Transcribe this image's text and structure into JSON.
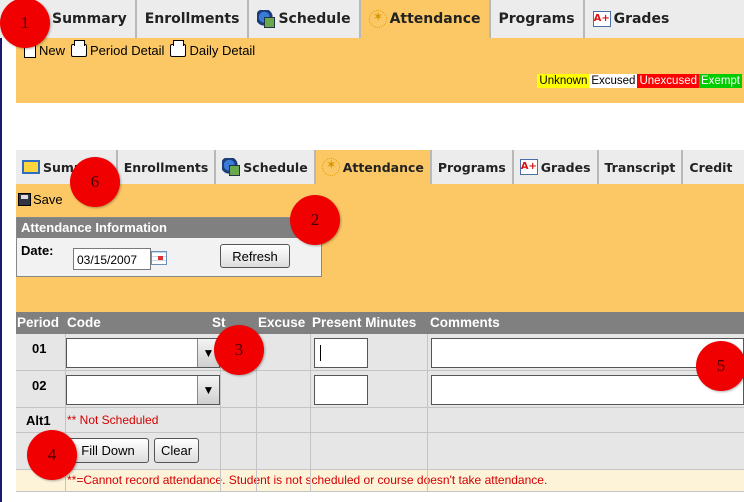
{
  "top_tabs": [
    {
      "label": "Summary",
      "active": false
    },
    {
      "label": "Enrollments",
      "active": false
    },
    {
      "label": "Schedule",
      "icon": "schedule-icon",
      "active": false
    },
    {
      "label": "Attendance",
      "icon": "attendance-icon",
      "active": true
    },
    {
      "label": "Programs",
      "active": false
    },
    {
      "label": "Grades",
      "icon": "grades-icon",
      "active": false
    }
  ],
  "top_toolbar": {
    "new_label": "New",
    "period_detail_label": "Period Detail",
    "daily_detail_label": "Daily Detail"
  },
  "legend": [
    {
      "label": "Unknown",
      "bg": "#ffff00",
      "fg": "#000000"
    },
    {
      "label": "Excused",
      "bg": "#ffffff",
      "fg": "#000000"
    },
    {
      "label": "Unexcused",
      "bg": "#ff0000",
      "fg": "#ffffff"
    },
    {
      "label": "Exempt",
      "bg": "#00cc00",
      "fg": "#ffffff"
    }
  ],
  "mid_tabs": [
    {
      "label": "Summary",
      "icon": "summary-icon",
      "active": false
    },
    {
      "label": "Enrollments",
      "active": false
    },
    {
      "label": "Schedule",
      "icon": "schedule-icon",
      "active": false
    },
    {
      "label": "Attendance",
      "icon": "attendance-icon",
      "active": true
    },
    {
      "label": "Programs",
      "active": false
    },
    {
      "label": "Grades",
      "icon": "grades-icon",
      "active": false
    },
    {
      "label": "Transcript",
      "active": false
    },
    {
      "label": "Credit",
      "active": false
    }
  ],
  "mid_toolbar": {
    "save_label": "Save"
  },
  "attendance_info": {
    "header": "Attendance Information",
    "date_label": "Date:",
    "date_value": "03/15/2007",
    "refresh_label": "Refresh"
  },
  "grid": {
    "headers": {
      "period": "Period",
      "code": "Code",
      "status": "St",
      "excuse": "Excuse",
      "present_minutes": "Present Minutes",
      "comments": "Comments"
    },
    "rows": [
      {
        "period": "01",
        "code": "",
        "minutes": "",
        "comment": ""
      },
      {
        "period": "02",
        "code": "",
        "minutes": "",
        "comment": ""
      }
    ],
    "alt_row": {
      "period": "Alt1",
      "note": "** Not Scheduled"
    },
    "fill_down_label": "Fill Down",
    "clear_label": "Clear",
    "footnote": "**=Cannot record attendance. Student is not scheduled or course doesn't take attendance."
  },
  "markers": [
    "1",
    "2",
    "3",
    "4",
    "5",
    "6"
  ],
  "colors": {
    "panel": "#fcc865",
    "header_gray": "#808080",
    "marker_red": "#f00000"
  }
}
